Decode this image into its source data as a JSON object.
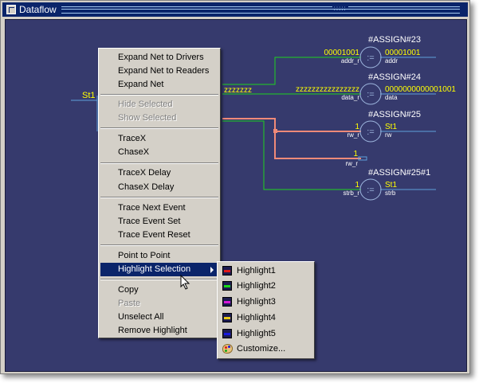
{
  "window": {
    "title": "Dataflow",
    "grip": ":::::"
  },
  "colors": {
    "canvas_bg": "#363a6d",
    "signal_green": "#1fd21f",
    "signal_cyan": "#5fa0dc",
    "highlight_salmon": "#f08a78",
    "value_yellow": "#ffff00",
    "menu_selected": "#0a246a"
  },
  "diagram": {
    "left_port_value": "St1",
    "bus_value_left": "zzzzzzz",
    "blocks": [
      {
        "name": "#ASSIGN#23",
        "symbol": ":=",
        "in_value": "00001001",
        "in_port": "addr_r",
        "out_value": "00001001",
        "out_port": "addr"
      },
      {
        "name": "#ASSIGN#24",
        "symbol": ":=",
        "in_value": "zzzzzzzzzzzzzzzz",
        "in_port": "data_r",
        "out_value": "0000000000001001",
        "out_port": "data"
      },
      {
        "name": "#ASSIGN#25",
        "symbol": ":=",
        "in_value": "1",
        "in_port": "rw_r",
        "out_value": "St1",
        "out_port": "rw"
      },
      {
        "name": "#ASSIGN#25#1",
        "symbol": ":=",
        "in_value": "1",
        "in_port": "strb_r",
        "out_value": "St1",
        "out_port": "strb"
      }
    ],
    "extra_port": {
      "value": "1",
      "name": "rw_r"
    }
  },
  "context_menu": {
    "items": [
      {
        "label": "Expand Net to Drivers",
        "enabled": true
      },
      {
        "label": "Expand Net to Readers",
        "enabled": true
      },
      {
        "label": "Expand Net",
        "enabled": true
      },
      {
        "label": "Hide Selected",
        "enabled": false
      },
      {
        "label": "Show Selected",
        "enabled": false
      },
      {
        "label": "TraceX",
        "enabled": true
      },
      {
        "label": "ChaseX",
        "enabled": true
      },
      {
        "label": "TraceX Delay",
        "enabled": true
      },
      {
        "label": "ChaseX Delay",
        "enabled": true
      },
      {
        "label": "Trace Next Event",
        "enabled": true
      },
      {
        "label": "Trace Event Set",
        "enabled": true
      },
      {
        "label": "Trace Event Reset",
        "enabled": true
      },
      {
        "label": "Point to Point",
        "enabled": true
      },
      {
        "label": "Highlight Selection",
        "enabled": true,
        "submenu": true,
        "selected": true
      },
      {
        "label": "Copy",
        "enabled": true
      },
      {
        "label": "Paste",
        "enabled": false
      },
      {
        "label": "Unselect All",
        "enabled": true
      },
      {
        "label": "Remove Highlight",
        "enabled": true
      }
    ]
  },
  "highlight_submenu": {
    "items": [
      {
        "label": "Highlight1",
        "color": "#e01818"
      },
      {
        "label": "Highlight2",
        "color": "#18d818"
      },
      {
        "label": "Highlight3",
        "color": "#d818d8"
      },
      {
        "label": "Highlight4",
        "color": "#e8c818"
      },
      {
        "label": "Highlight5",
        "color": "#1818e0"
      },
      {
        "label": "Customize...",
        "icon": "palette-icon"
      }
    ]
  }
}
